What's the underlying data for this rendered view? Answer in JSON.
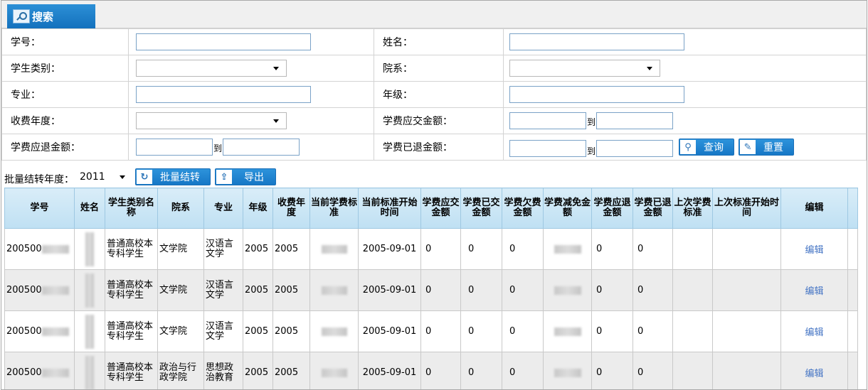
{
  "search_tab": {
    "label": "搜索",
    "icon": "magnifier-icon"
  },
  "form": {
    "student_id_label": "学号：",
    "name_label": "姓名：",
    "student_type_label": "学生类别：",
    "department_label": "院系：",
    "major_label": "专业：",
    "grade_label": "年级：",
    "fee_year_label": "收费年度：",
    "fee_due_label": "学费应交金额：",
    "refund_due_label": "学费应退金额：",
    "refunded_label": "学费已退金额：",
    "to_text": "到",
    "query_button": "查询",
    "reset_button": "重置"
  },
  "batch": {
    "year_label": "批量结转年度：",
    "year_value": "2011",
    "transfer_button": "批量结转",
    "export_button": "导出"
  },
  "grid": {
    "headers": [
      "学号",
      "姓名",
      "学生类别名称",
      "院系",
      "专业",
      "年级",
      "收费年度",
      "当前学费标准",
      "当前标准开始时间",
      "学费应交金额",
      "学费已交金额",
      "学费欠费金额",
      "学费减免金额",
      "学费应退金额",
      "学费已退金额",
      "上次学费标准",
      "上次标准开始时间",
      "编辑"
    ],
    "rows": [
      {
        "id_prefix": "200500",
        "type": "普通高校本专科学生",
        "dept": "文学院",
        "major": "汉语言文学",
        "grade": "2005",
        "fee_year": "2005",
        "start": "2005-09-01",
        "due": "0",
        "paid": "0",
        "owed": "0",
        "refund_due": "0",
        "refunded": "0",
        "edit": "编辑"
      },
      {
        "id_prefix": "200500",
        "type": "普通高校本专科学生",
        "dept": "文学院",
        "major": "汉语言文学",
        "grade": "2005",
        "fee_year": "2005",
        "start": "2005-09-01",
        "due": "0",
        "paid": "0",
        "owed": "0",
        "refund_due": "0",
        "refunded": "0",
        "edit": "编辑"
      },
      {
        "id_prefix": "200500",
        "type": "普通高校本专科学生",
        "dept": "文学院",
        "major": "汉语言文学",
        "grade": "2005",
        "fee_year": "2005",
        "start": "2005-09-01",
        "due": "0",
        "paid": "0",
        "owed": "0",
        "refund_due": "0",
        "refunded": "0",
        "edit": "编辑"
      },
      {
        "id_prefix": "200500",
        "type": "普通高校本专科学生",
        "dept": "政治与行政学院",
        "major": "思想政治教育",
        "grade": "2005",
        "fee_year": "2005",
        "start": "2005-09-01",
        "due": "0",
        "paid": "0",
        "owed": "0",
        "refund_due": "0",
        "refunded": "0",
        "edit": "编辑"
      }
    ]
  }
}
